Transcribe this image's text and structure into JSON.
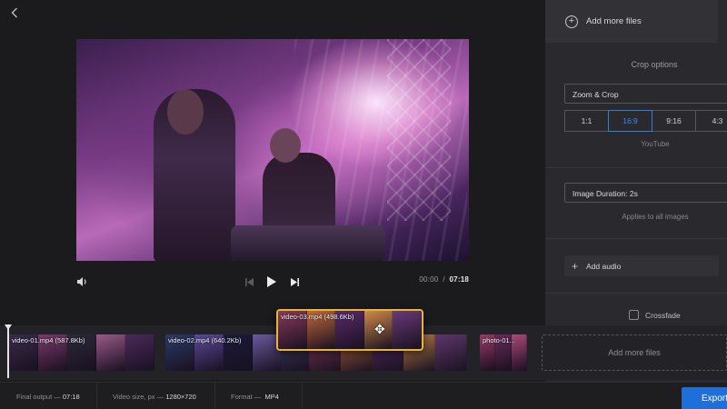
{
  "player": {
    "current_time": "00:00",
    "separator": "/",
    "duration": "07:18"
  },
  "panel": {
    "add_more_files": "Add more files",
    "crop_options_title": "Crop options",
    "crop_mode": "Zoom & Crop",
    "ratios": [
      "1:1",
      "16:9",
      "9:16",
      "4:3"
    ],
    "active_ratio_index": 1,
    "ratio_hint": "YouTube",
    "image_duration": "Image Duration: 2s",
    "image_duration_hint": "Applies to all images",
    "add_audio": "Add audio",
    "crossfade": "Crossfade",
    "crossfade_checked": false
  },
  "timeline": {
    "clips": [
      {
        "label": "video-01.mp4 (587.8Kb)",
        "colors": [
          "#3a2a4a",
          "#7a3a6a",
          "#2a2a3a",
          "#9a5a8a",
          "#4a2a5a"
        ]
      },
      {
        "label": "video-02.mp4 (640.2Kb)",
        "colors": [
          "#2a3a6a",
          "#5a4a9a",
          "#1a1a3a",
          "#6a5aa0",
          "#3a3a5a"
        ]
      },
      {
        "label": "video-03.mp4 (498.6Kb)",
        "colors": [
          "#8a3a5a",
          "#c06a3a",
          "#5a2a6a",
          "#d08a4a",
          "#6a3a7a"
        ]
      },
      {
        "label": "photo-01...",
        "colors": [
          "#9a3a6a",
          "#6a2a5a",
          "#aa4a7a"
        ]
      }
    ],
    "dragging_clip_label": "video-03.mp4 (498.6Kb)",
    "add_more_files": "Add more files"
  },
  "status": {
    "final_output_label": "Final output —",
    "final_output_value": "07:18",
    "video_size_label": "Video size, px —",
    "video_size_value": "1280×720",
    "format_label": "Format —",
    "format_value": "MP4",
    "export_label": "Export"
  }
}
